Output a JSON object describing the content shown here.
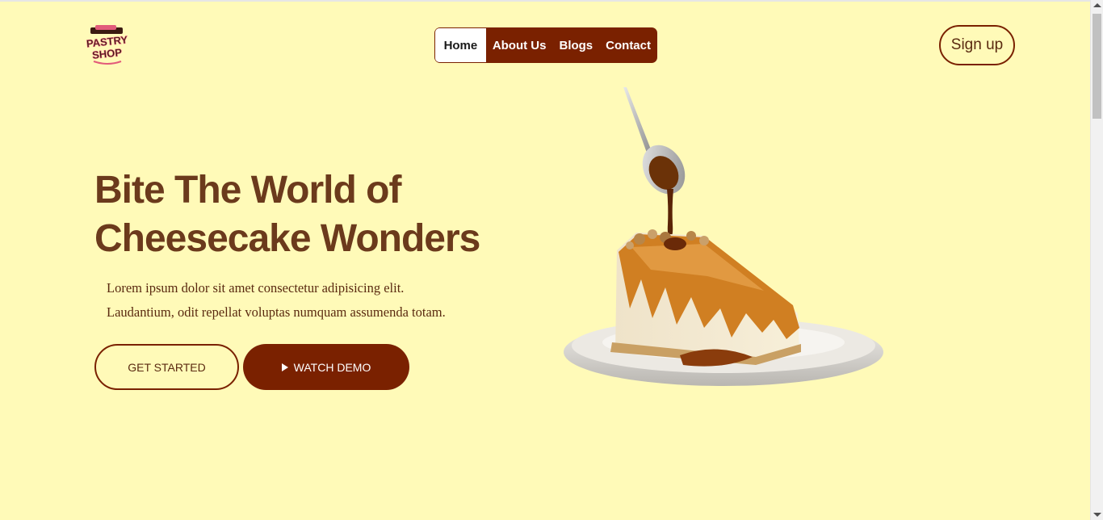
{
  "brand": {
    "logo_text_line1": "PASTRY",
    "logo_text_line2": "SHOP"
  },
  "nav": {
    "items": [
      {
        "label": "Home",
        "active": true
      },
      {
        "label": "About Us",
        "active": false
      },
      {
        "label": "Blogs",
        "active": false
      },
      {
        "label": "Contact",
        "active": false
      }
    ]
  },
  "header": {
    "signup_label": "Sign up"
  },
  "hero": {
    "title_line1": "Bite The World of",
    "title_line2": "Cheesecake Wonders",
    "desc_line1": "Lorem ipsum dolor sit amet consectetur adipisicing elit.",
    "desc_line2": "Laudantium, odit repellat voluptas numquam assumenda totam.",
    "get_started_label": "GET STARTED",
    "watch_demo_label": "WATCH DEMO"
  },
  "colors": {
    "background": "#fffab8",
    "accent": "#7a2100",
    "heading": "#6b3a1c"
  },
  "icons": {
    "play": "play-icon",
    "logo": "pastry-shop-logo"
  }
}
